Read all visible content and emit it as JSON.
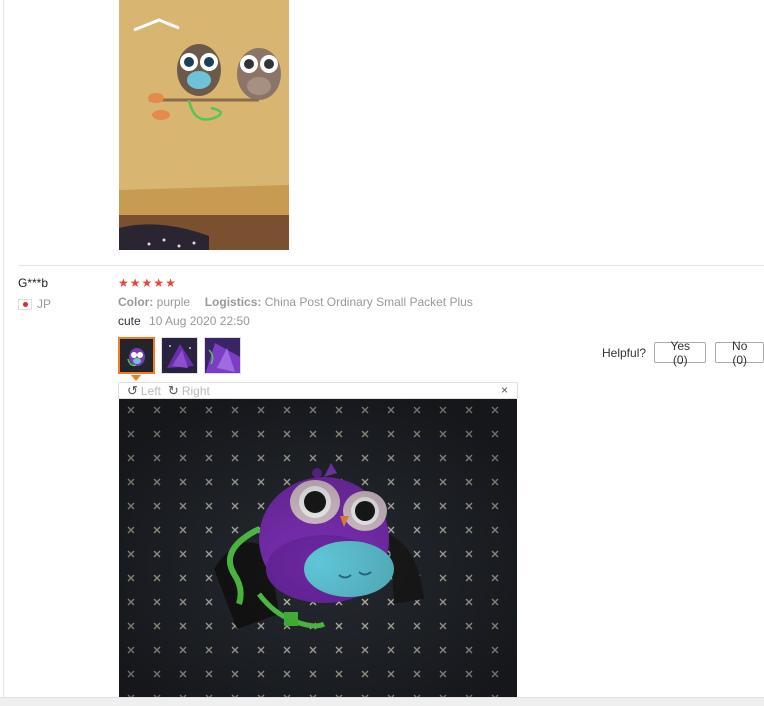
{
  "review": {
    "user_name": "G***b",
    "country": "JP",
    "rating": 5,
    "stars": [
      "★",
      "★",
      "★",
      "★",
      "★"
    ],
    "attributes": {
      "color_label": "Color:",
      "color_value": "purple",
      "logistics_label": "Logistics:",
      "logistics_value": "China Post Ordinary Small Packet Plus"
    },
    "text": "cute",
    "date": "10 Aug 2020 22:50",
    "thumbnails": [
      "thumb-1",
      "thumb-2",
      "thumb-3"
    ]
  },
  "helpful": {
    "label": "Helpful?",
    "yes_label": "Yes (0)",
    "no_label": "No (0)"
  },
  "viewer": {
    "rotate_left_label": "Left",
    "rotate_right_label": "Right",
    "close_glyph": "×"
  },
  "colors": {
    "star": "#e8453c",
    "active_thumb_border": "#f47b20"
  }
}
